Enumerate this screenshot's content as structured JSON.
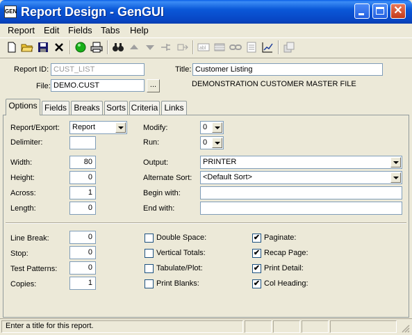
{
  "window": {
    "title": "Report Design - GenGUI",
    "icon_text": "GEN"
  },
  "menu": [
    "Report",
    "Edit",
    "Fields",
    "Tabs",
    "Help"
  ],
  "header": {
    "report_id_label": "Report ID:",
    "report_id_value": "CUST_LIST",
    "file_label": "File:",
    "file_value": "DEMO.CUST",
    "browse_label": "...",
    "title_label": "Title:",
    "title_value": "Customer Listing",
    "file_description": "DEMONSTRATION CUSTOMER MASTER FILE"
  },
  "tabs": [
    "Options",
    "Fields",
    "Breaks",
    "Sorts",
    "Criteria",
    "Links"
  ],
  "options": {
    "report_export_label": "Report/Export:",
    "report_export_value": "Report",
    "delimiter_label": "Delimiter:",
    "delimiter_value": "",
    "modify_label": "Modify:",
    "modify_value": "0",
    "run_label": "Run:",
    "run_value": "0",
    "width_label": "Width:",
    "width_value": "80",
    "height_label": "Height:",
    "height_value": "0",
    "across_label": "Across:",
    "across_value": "1",
    "length_label": "Length:",
    "length_value": "0",
    "output_label": "Output:",
    "output_value": "PRINTER",
    "alt_sort_label": "Alternate Sort:",
    "alt_sort_value": "<Default Sort>",
    "begin_with_label": "Begin with:",
    "begin_with_value": "",
    "end_with_label": "End with:",
    "end_with_value": "",
    "line_break_label": "Line Break:",
    "line_break_value": "0",
    "stop_label": "Stop:",
    "stop_value": "0",
    "test_patterns_label": "Test Patterns:",
    "test_patterns_value": "0",
    "copies_label": "Copies:",
    "copies_value": "1",
    "checkboxes_left": [
      {
        "label": "Double Space:",
        "checked": false
      },
      {
        "label": "Vertical Totals:",
        "checked": false
      },
      {
        "label": "Tabulate/Plot:",
        "checked": false
      },
      {
        "label": "Print Blanks:",
        "checked": false
      }
    ],
    "checkboxes_right": [
      {
        "label": "Paginate:",
        "checked": true
      },
      {
        "label": "Recap Page:",
        "checked": true
      },
      {
        "label": "Print Detail:",
        "checked": true
      },
      {
        "label": "Col Heading:",
        "checked": true
      }
    ]
  },
  "status": {
    "message": "Enter a title for this report."
  },
  "colors": {
    "titlebar": "#0a58d8",
    "window_bg": "#ece9d8",
    "field_border": "#7f9db9"
  }
}
